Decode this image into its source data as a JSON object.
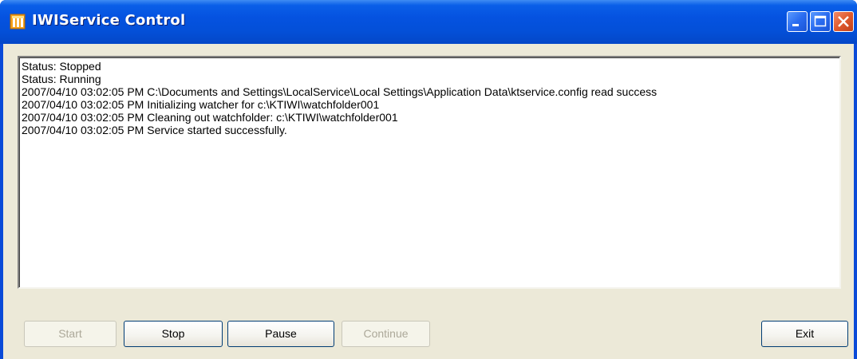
{
  "window": {
    "title": "IWIService Control",
    "controls": [
      "minimize-icon",
      "maximize-icon",
      "close-icon"
    ]
  },
  "log": {
    "lines": [
      "Status: Stopped",
      "Status: Running",
      "2007/04/10 03:02:05 PM C:\\Documents and Settings\\LocalService\\Local Settings\\Application Data\\ktservice.config read success",
      "2007/04/10 03:02:05 PM Initializing watcher for c:\\KTIWI\\watchfolder001",
      "2007/04/10 03:02:05 PM Cleaning out watchfolder: c:\\KTIWI\\watchfolder001",
      "2007/04/10 03:02:05 PM Service started successfully."
    ]
  },
  "buttons": {
    "start": {
      "label": "Start",
      "enabled": false
    },
    "stop": {
      "label": "Stop",
      "enabled": true
    },
    "pause": {
      "label": "Pause",
      "enabled": true
    },
    "continue": {
      "label": "Continue",
      "enabled": false
    },
    "exit": {
      "label": "Exit",
      "enabled": true
    }
  },
  "colors": {
    "titlebar": "#0552e0",
    "client_background": "#ece9d8",
    "close_button": "#e05a2e"
  }
}
